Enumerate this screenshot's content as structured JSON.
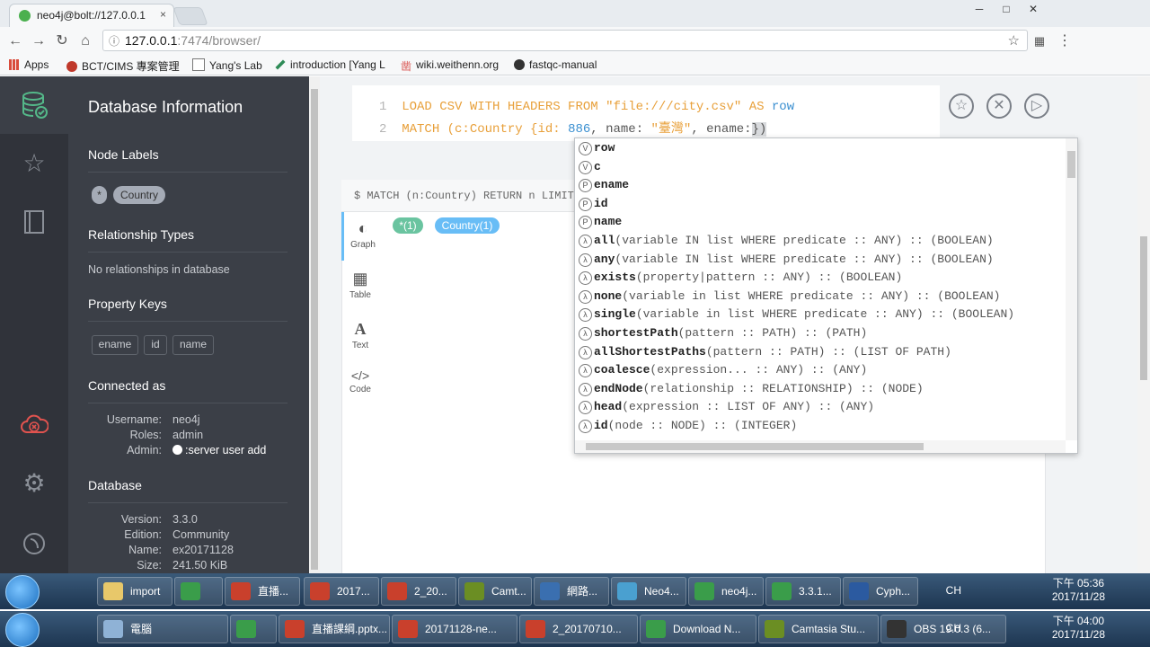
{
  "browser": {
    "tab_title": "neo4j@bolt://127.0.0.1",
    "tab_close": "×",
    "url_host": "127.0.0.1",
    "url_rest": ":7474/browser/",
    "window_controls": [
      "─",
      "□",
      "✕"
    ],
    "bookmarks": [
      {
        "label": "Apps",
        "icon": "apps-grid-icon",
        "color": "#d94c3c"
      },
      {
        "label": "BCT/CIMS 專案管理",
        "icon": "bookmark-icon",
        "color": "#c0392b"
      },
      {
        "label": "Yang's Lab",
        "icon": "page-icon",
        "color": "#777777"
      },
      {
        "label": "introduction [Yang L",
        "icon": "pen-icon",
        "color": "#2e8b57"
      },
      {
        "label": "wiki.weithenn.org",
        "icon": "kanji-icon",
        "color": "#d9534f"
      },
      {
        "label": "fastqc-manual",
        "icon": "github-icon",
        "color": "#333333"
      }
    ]
  },
  "sidebar": {
    "title": "Database Information",
    "node_labels_heading": "Node Labels",
    "node_labels": [
      "*",
      "Country"
    ],
    "rel_types_heading": "Relationship Types",
    "rel_types_text": "No relationships in database",
    "property_keys_heading": "Property Keys",
    "property_keys": [
      "ename",
      "id",
      "name"
    ],
    "connected_heading": "Connected as",
    "connection": [
      {
        "key": "Username:",
        "value": "neo4j"
      },
      {
        "key": "Roles:",
        "value": "admin"
      },
      {
        "key": "Admin:",
        "value": ":server user add"
      }
    ],
    "database_heading": "Database",
    "database": [
      {
        "key": "Version:",
        "value": "3.3.0"
      },
      {
        "key": "Edition:",
        "value": "Community"
      },
      {
        "key": "Name:",
        "value": "ex20171128"
      },
      {
        "key": "Size:",
        "value": "241.50 KiB"
      }
    ]
  },
  "editor": {
    "line1_no": "1",
    "line1_kw": "LOAD CSV WITH HEADERS FROM ",
    "line1_str": "\"file:///city.csv\"",
    "line1_as": " AS ",
    "line1_var": "row",
    "line2_no": "2",
    "line2_kw": "MATCH (",
    "line2_a": "c:Country {id: ",
    "line2_num": "886",
    "line2_b": ", name: ",
    "line2_str": "\"臺灣\"",
    "line2_c": ", ename:",
    "line2_d": "})"
  },
  "frame": {
    "query": "$ MATCH (n:Country) RETURN n LIMIT 25",
    "view_tabs": [
      {
        "label": "Graph",
        "glyph": "◐"
      },
      {
        "label": "Table",
        "glyph": "▦"
      },
      {
        "label": "Text",
        "glyph": "A"
      },
      {
        "label": "Code",
        "glyph": "</>"
      }
    ],
    "result_pills": [
      "*(1)",
      "Country(1)"
    ]
  },
  "autocomplete": [
    {
      "badge": "V",
      "name": "row",
      "sig": ""
    },
    {
      "badge": "V",
      "name": "c",
      "sig": ""
    },
    {
      "badge": "P",
      "name": "ename",
      "sig": ""
    },
    {
      "badge": "P",
      "name": "id",
      "sig": ""
    },
    {
      "badge": "P",
      "name": "name",
      "sig": ""
    },
    {
      "badge": "λ",
      "name": "all",
      "sig": "(variable IN list WHERE predicate :: ANY) :: (BOOLEAN)"
    },
    {
      "badge": "λ",
      "name": "any",
      "sig": "(variable IN list WHERE predicate :: ANY) :: (BOOLEAN)"
    },
    {
      "badge": "λ",
      "name": "exists",
      "sig": "(property|pattern :: ANY) :: (BOOLEAN)"
    },
    {
      "badge": "λ",
      "name": "none",
      "sig": "(variable in list WHERE predicate :: ANY) :: (BOOLEAN)"
    },
    {
      "badge": "λ",
      "name": "single",
      "sig": "(variable in list WHERE predicate :: ANY) :: (BOOLEAN)"
    },
    {
      "badge": "λ",
      "name": "shortestPath",
      "sig": "(pattern :: PATH) :: (PATH)"
    },
    {
      "badge": "λ",
      "name": "allShortestPaths",
      "sig": "(pattern :: PATH) :: (LIST OF PATH)"
    },
    {
      "badge": "λ",
      "name": "coalesce",
      "sig": "(expression... :: ANY) :: (ANY)"
    },
    {
      "badge": "λ",
      "name": "endNode",
      "sig": "(relationship :: RELATIONSHIP) :: (NODE)"
    },
    {
      "badge": "λ",
      "name": "head",
      "sig": "(expression :: LIST OF ANY) :: (ANY)"
    },
    {
      "badge": "λ",
      "name": "id",
      "sig": "(node :: NODE) :: (INTEGER)"
    }
  ],
  "taskbar1": {
    "items": [
      "import",
      "",
      "直播...",
      "2017...",
      "2_20...",
      "Camt...",
      "網路...",
      "Neo4...",
      "neo4j...",
      "3.3.1...",
      "Cyph..."
    ],
    "lang": "CH",
    "time": "下午 05:36",
    "date": "2017/11/28"
  },
  "taskbar2": {
    "items": [
      "電腦",
      "",
      "直播課綱.pptx...",
      "20171128-ne...",
      "2_20170710...",
      "Download N...",
      "Camtasia Stu...",
      "OBS 19.0.3 (6..."
    ],
    "lang": "CH",
    "time": "下午 04:00",
    "date": "2017/11/28"
  },
  "colors": {
    "sidebar_bg": "#3b3f47",
    "iconbar_bg": "#30333a",
    "active_icon": "#54b889",
    "alert_icon": "#e0534f",
    "keyword": "#e8a03a",
    "number": "#3a8fd0",
    "pill_all": "#6ac4a0",
    "pill_country": "#68bdf6"
  }
}
